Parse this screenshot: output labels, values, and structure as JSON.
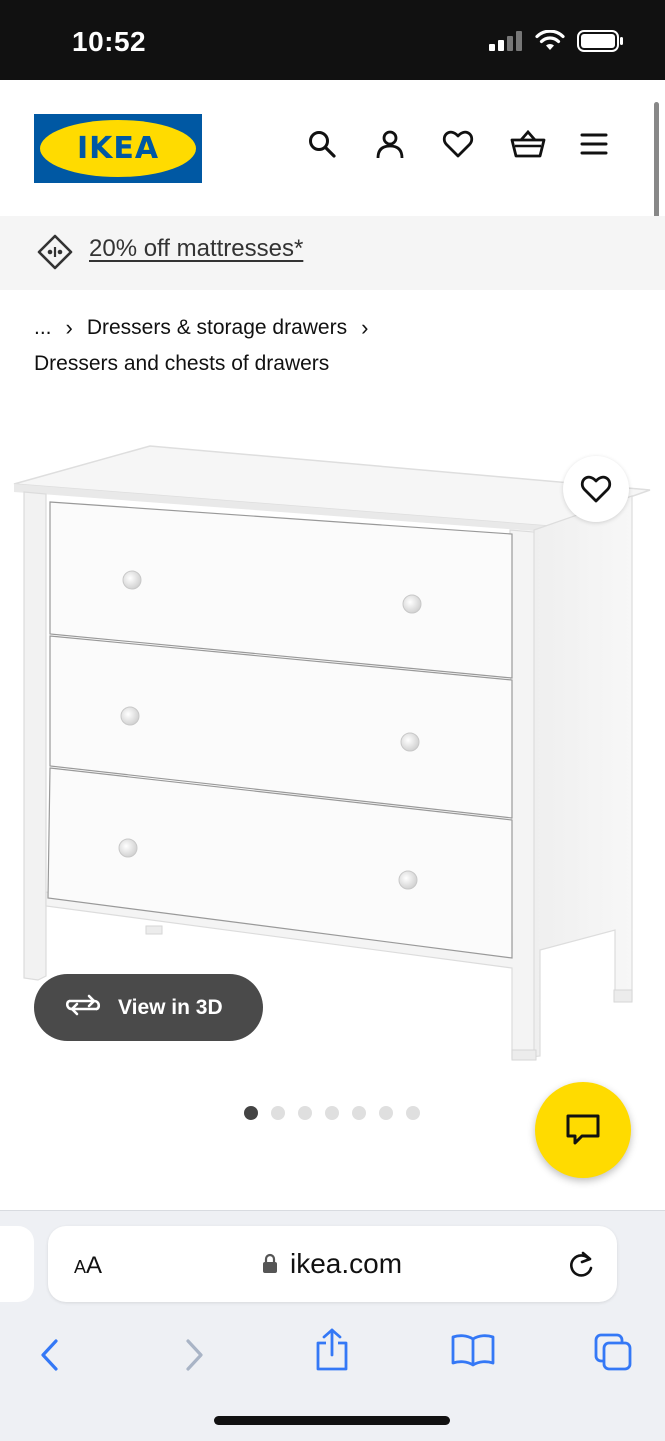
{
  "status_bar": {
    "time": "10:52"
  },
  "header": {
    "logo_text": "IKEA",
    "icons": [
      "search-icon",
      "account-icon",
      "heart-icon",
      "basket-icon",
      "menu-icon"
    ]
  },
  "promo": {
    "text": "20% off mattresses*"
  },
  "breadcrumb": {
    "ellipsis": "...",
    "sep": "›",
    "level1": "Dressers & storage drawers",
    "level2": "Dressers and chests of drawers"
  },
  "product": {
    "view3d_label": "View in 3D",
    "image_count": 7,
    "active_image_index": 0
  },
  "browser": {
    "text_size_label_big": "A",
    "text_size_label_small": "A",
    "url": "ikea.com"
  },
  "colors": {
    "ikea_blue": "#0058a3",
    "ikea_yellow": "#ffdb00",
    "ios_blue": "#3478f6"
  }
}
